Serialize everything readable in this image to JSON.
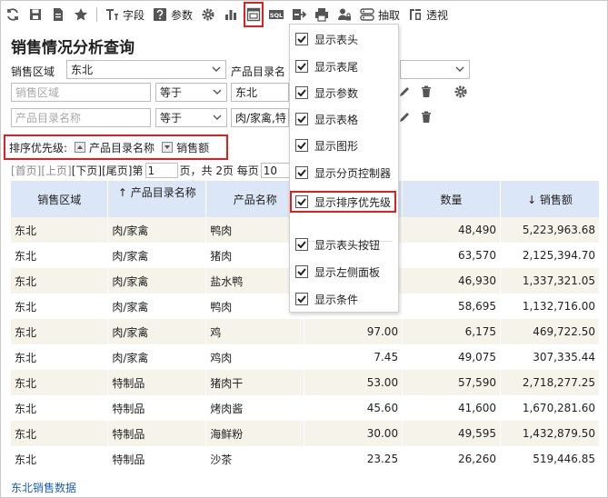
{
  "toolbar": {
    "field_label": "字段",
    "param_label": "参数",
    "extract_label": "抽取",
    "pivot_label": "透视",
    "sql_label": "SQL"
  },
  "page_title": "销售情况分析查询",
  "conditions": {
    "region_label": "销售区域",
    "region_value": "东北",
    "catalog_label": "产品目录名",
    "row2": {
      "field_placeholder": "销售区域",
      "operator": "等于",
      "value": "东北"
    },
    "row3": {
      "field_placeholder": "产品目录名称",
      "operator": "等于",
      "value": "肉/家禽,特"
    }
  },
  "sort": {
    "label": "排序优先级:",
    "chips": [
      "产品目录名称",
      "销售额"
    ]
  },
  "pager": {
    "first": "[首页]",
    "prev": "[上页]",
    "next": "[下页]",
    "last": "[尾页]",
    "page_prefix": "第",
    "page_value": "1",
    "page_suffix": "页，共 2页 每页",
    "page_size": "10"
  },
  "table": {
    "headers": [
      "销售区域",
      "↑ 产品目录名称",
      "产品名称",
      "",
      "数量",
      "↓ 销售额"
    ],
    "rows": [
      [
        "东北",
        "肉/家禽",
        "鸭肉",
        "",
        "48,490",
        "5,223,963.68"
      ],
      [
        "东北",
        "肉/家禽",
        "猪肉",
        "",
        "63,570",
        "2,125,394.70"
      ],
      [
        "东北",
        "肉/家禽",
        "盐水鸭",
        "",
        "46,930",
        "1,337,321.05"
      ],
      [
        "东北",
        "肉/家禽",
        "鸭肉",
        "",
        "58,695",
        "1,132,716.00"
      ],
      [
        "东北",
        "肉/家禽",
        "鸡",
        "97.00",
        "6,175",
        "469,722.50"
      ],
      [
        "东北",
        "肉/家禽",
        "鸡肉",
        "7.45",
        "49,075",
        "307,335.44"
      ],
      [
        "东北",
        "特制品",
        "猪肉干",
        "53.00",
        "57,590",
        "2,718,277.25"
      ],
      [
        "东北",
        "特制品",
        "烤肉酱",
        "45.60",
        "41,600",
        "1,670,281.60"
      ],
      [
        "东北",
        "特制品",
        "海鲜粉",
        "30.00",
        "49,595",
        "1,432,879.50"
      ],
      [
        "东北",
        "特制品",
        "沙茶",
        "23.25",
        "26,260",
        "519,446.85"
      ]
    ]
  },
  "footer_link": "东北销售数据",
  "menu": {
    "items": [
      {
        "label": "显示表头",
        "checked": true
      },
      {
        "label": "显示表尾",
        "checked": true
      },
      {
        "label": "显示参数",
        "checked": true
      },
      {
        "label": "显示表格",
        "checked": true
      },
      {
        "label": "显示图形",
        "checked": true
      },
      {
        "label": "显示分页控制器",
        "checked": true
      },
      {
        "label": "显示排序优先级",
        "checked": true
      },
      {
        "label": "显示表头按钮",
        "checked": true
      },
      {
        "label": "显示左侧面板",
        "checked": true
      },
      {
        "label": "显示条件",
        "checked": true
      }
    ]
  },
  "colors": {
    "accent_red": "#e02020",
    "header_blue": "#dbe7f6",
    "row_stripe": "#f6f3ea",
    "link_blue": "#1a5fb4"
  }
}
